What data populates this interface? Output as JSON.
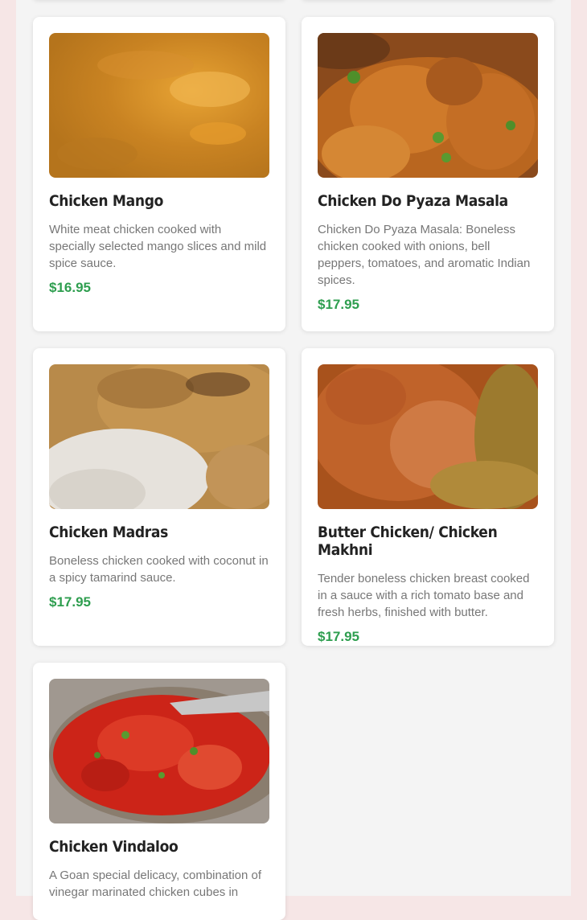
{
  "menu": {
    "items": [
      {
        "title": "Chicken Mango",
        "description": "White meat chicken cooked with specially selected mango slices and mild spice sauce.",
        "price": "$16.95"
      },
      {
        "title": "Chicken Do Pyaza Masala",
        "description": "Chicken Do Pyaza Masala: Boneless chicken cooked with onions, bell peppers, tomatoes, and aromatic Indian spices.",
        "price": "$17.95"
      },
      {
        "title": "Chicken Madras",
        "description": "Boneless chicken cooked with coconut in a spicy tamarind sauce.",
        "price": "$17.95"
      },
      {
        "title": "Butter Chicken/ Chicken Makhni",
        "description": "Tender boneless chicken breast cooked in a sauce with a rich tomato base and fresh herbs, finished with butter.",
        "price": "$17.95"
      },
      {
        "title": "Chicken Vindaloo",
        "description": "A Goan special delicacy, combination of vinegar marinated chicken cubes in",
        "price": ""
      }
    ]
  },
  "colors": {
    "price": "#2e9e4f",
    "outer_background": "#f6e6e6",
    "page_background": "#f4f4f4"
  }
}
